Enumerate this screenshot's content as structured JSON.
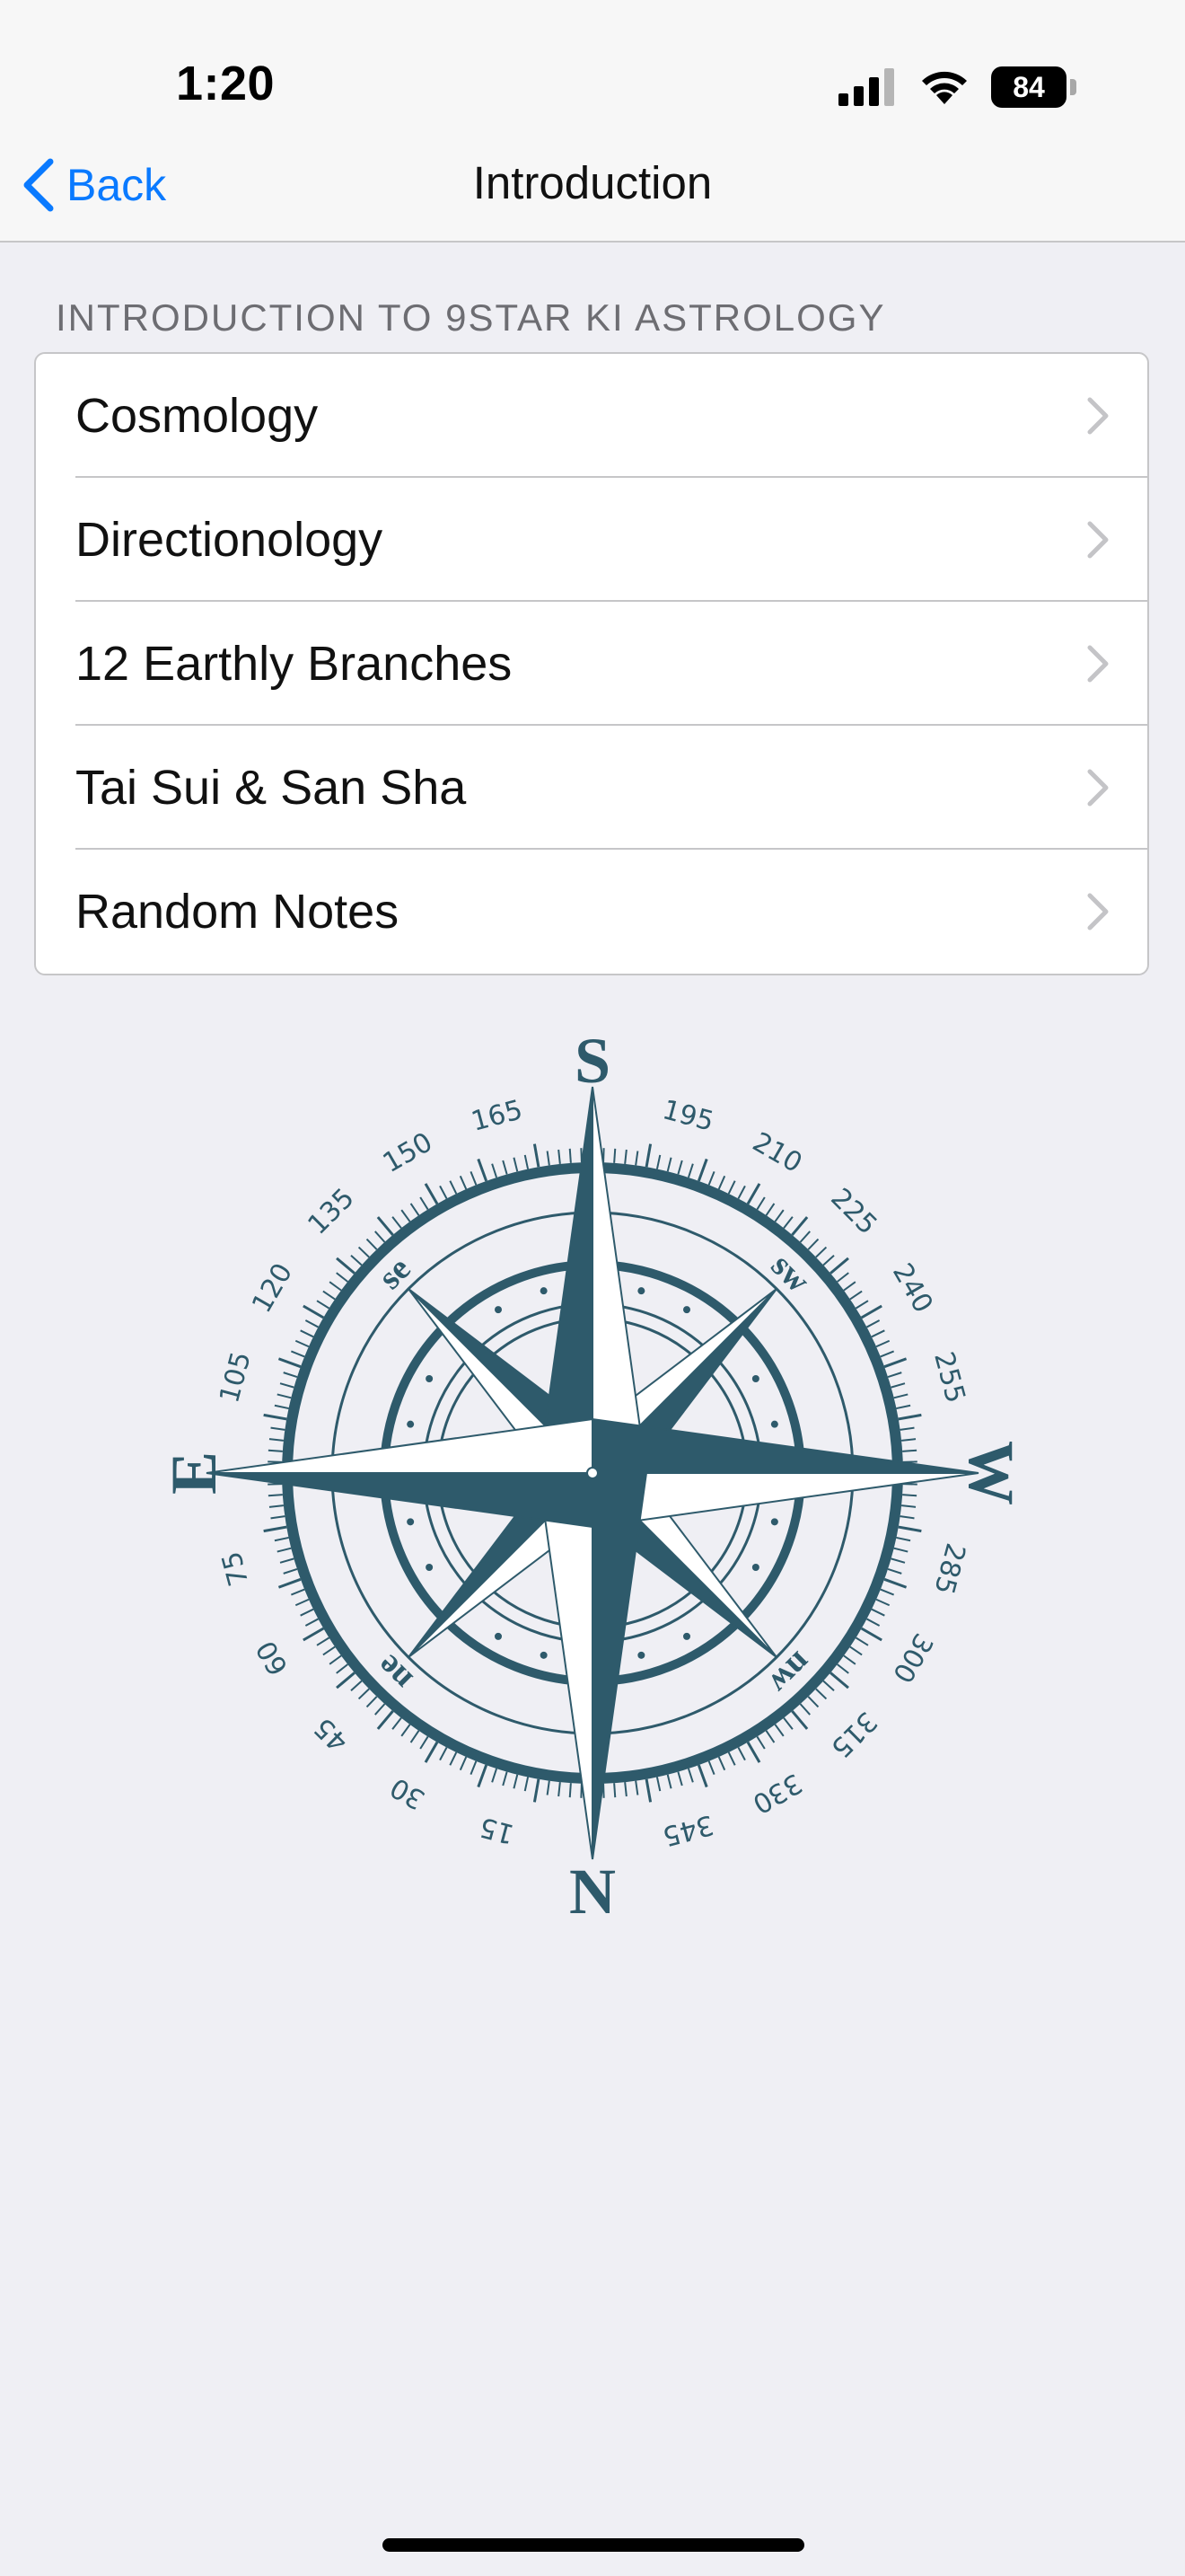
{
  "status": {
    "time": "1:20",
    "battery": "84",
    "icons": [
      "signal-icon",
      "wifi-icon",
      "battery-icon"
    ]
  },
  "nav": {
    "back_label": "Back",
    "title": "Introduction"
  },
  "section": {
    "header": "INTRODUCTION TO 9STAR KI ASTROLOGY",
    "items": [
      {
        "label": "Cosmology"
      },
      {
        "label": "Directionology"
      },
      {
        "label": "12 Earthly Branches"
      },
      {
        "label": "Tai Sui & San Sha"
      },
      {
        "label": "Random Notes"
      }
    ]
  },
  "compass": {
    "cardinals": {
      "top": "S",
      "bottom": "N",
      "left": "E",
      "right": "W"
    },
    "intercardinals": {
      "upper_left": "se",
      "upper_right": "sw",
      "lower_left": "ne",
      "lower_right": "nw"
    },
    "degree_labels": [
      "195",
      "210",
      "225",
      "240",
      "255",
      "285",
      "300",
      "315",
      "330",
      "345",
      "15",
      "30",
      "45",
      "60",
      "75",
      "105",
      "120",
      "135",
      "150",
      "165"
    ],
    "color": "#2e5a6b"
  },
  "colors": {
    "accent": "#0a7aff",
    "background": "#efeff4"
  }
}
